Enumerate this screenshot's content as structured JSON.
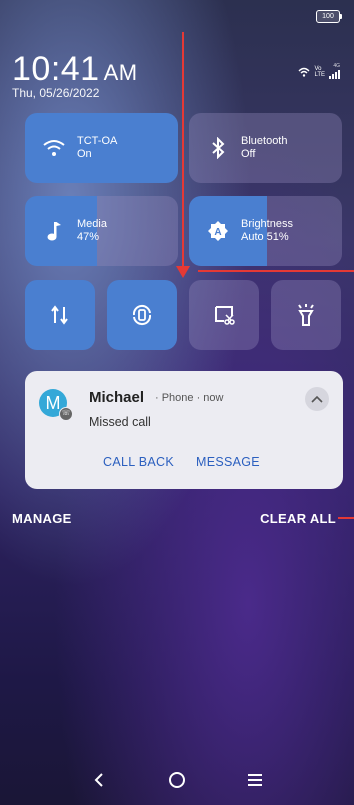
{
  "status_bar": {
    "battery": "100"
  },
  "clock": {
    "time": "10:41",
    "ampm": "AM",
    "date": "Thu, 05/26/2022"
  },
  "network_icons": {
    "volte_top": "Vo",
    "volte_bottom": "LTE",
    "gen": "4G"
  },
  "tiles": [
    {
      "name": "wifi",
      "title": "TCT-OA",
      "status": "On",
      "active": true
    },
    {
      "name": "bluetooth",
      "title": "Bluetooth",
      "status": "Off",
      "active": false
    },
    {
      "name": "media",
      "title": "Media",
      "status": "47%",
      "level": 0.47
    },
    {
      "name": "brightness",
      "title": "Brightness",
      "status": "Auto 51%",
      "level": 0.51
    }
  ],
  "quick_buttons": [
    {
      "icon": "data-transfer-icon",
      "active": true
    },
    {
      "icon": "auto-rotate-icon",
      "active": true
    },
    {
      "icon": "screenshot-icon",
      "active": false
    },
    {
      "icon": "flashlight-icon",
      "active": false
    }
  ],
  "notification": {
    "avatar_letter": "M",
    "name": "Michael",
    "meta": "· Phone · now",
    "message": "Missed call",
    "actions": [
      "CALL BACK",
      "MESSAGE"
    ]
  },
  "footer": {
    "manage": "MANAGE",
    "clear_all": "CLEAR ALL"
  },
  "colors": {
    "accent": "#4a7fd0",
    "annotation": "#e53935",
    "notification_bg": "#ececf2"
  }
}
